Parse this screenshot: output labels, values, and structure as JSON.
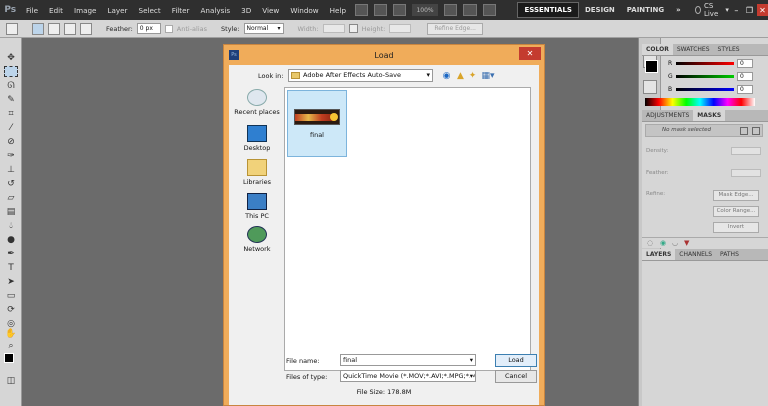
{
  "menubar": {
    "logo": "Ps",
    "items": [
      "File",
      "Edit",
      "Image",
      "Layer",
      "Select",
      "Filter",
      "Analysis",
      "3D",
      "View",
      "Window",
      "Help"
    ],
    "zoom": "100%",
    "workspaces": [
      "ESSENTIALS",
      "DESIGN",
      "PAINTING"
    ],
    "more": "»",
    "cslive": "CS Live"
  },
  "options": {
    "feather_label": "Feather:",
    "feather_value": "0 px",
    "antialias_label": "Anti-alias",
    "style_label": "Style:",
    "style_value": "Normal",
    "width_label": "Width:",
    "height_label": "Height:",
    "refine_edge_label": "Refine Edge..."
  },
  "panels": {
    "color_tabs": [
      "COLOR",
      "SWATCHES",
      "STYLES"
    ],
    "sliders": [
      {
        "letter": "R",
        "value": "0",
        "color": "#ff0000"
      },
      {
        "letter": "G",
        "value": "0",
        "color": "#00b000"
      },
      {
        "letter": "B",
        "value": "0",
        "color": "#0000ff"
      }
    ],
    "mask_tabs": [
      "ADJUSTMENTS",
      "MASKS"
    ],
    "mask_status": "No mask selected",
    "density_label": "Density:",
    "feather_label": "Feather:",
    "refine_label": "Refine:",
    "mask_edge_label": "Mask Edge...",
    "color_range_label": "Color Range...",
    "invert_label": "Invert",
    "layers_tabs": [
      "LAYERS",
      "CHANNELS",
      "PATHS"
    ]
  },
  "dialog": {
    "title": "Load",
    "ps_icon": "Ps",
    "close": "✕",
    "lookin_label": "Look in:",
    "lookin_value": "Adobe After Effects Auto-Save",
    "places": [
      "Recent places",
      "Desktop",
      "Libraries",
      "This PC",
      "Network"
    ],
    "file_name": "final",
    "filename_label": "File name:",
    "filename_value": "final",
    "filetype_label": "Files of type:",
    "filetype_value": "QuickTime Movie (*.MOV;*.AVI;*.MPG;*.MPEG",
    "load_label": "Load",
    "cancel_label": "Cancel",
    "file_size": "File Size: 178.8M"
  }
}
